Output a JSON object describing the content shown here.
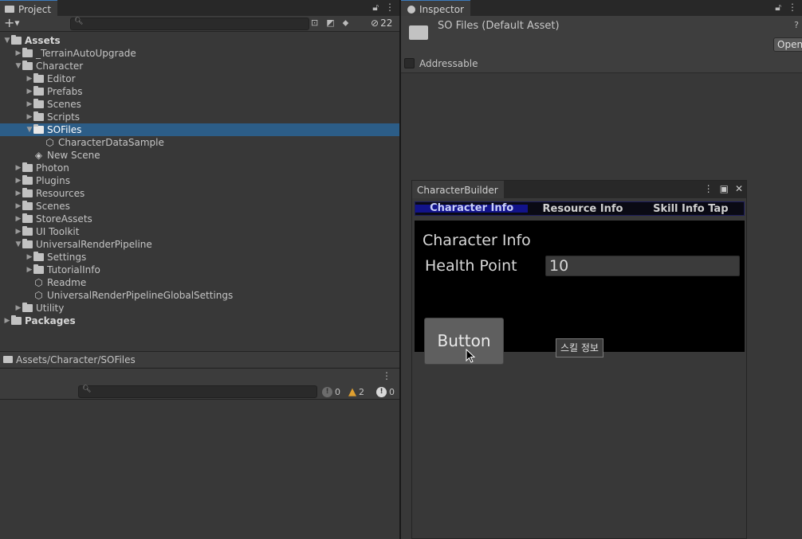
{
  "project": {
    "tab_title": "Project",
    "hidden_count": "22",
    "tree": [
      {
        "label": "Assets",
        "depth": 0,
        "expanded": true,
        "bold": true,
        "type": "folder"
      },
      {
        "label": "_TerrainAutoUpgrade",
        "depth": 1,
        "expanded": false,
        "type": "folder"
      },
      {
        "label": "Character",
        "depth": 1,
        "expanded": true,
        "type": "folder"
      },
      {
        "label": "Editor",
        "depth": 2,
        "expanded": false,
        "type": "folder"
      },
      {
        "label": "Prefabs",
        "depth": 2,
        "expanded": false,
        "type": "folder"
      },
      {
        "label": "Scenes",
        "depth": 2,
        "expanded": false,
        "type": "folder"
      },
      {
        "label": "Scripts",
        "depth": 2,
        "expanded": false,
        "type": "folder"
      },
      {
        "label": "SOFiles",
        "depth": 2,
        "expanded": true,
        "selected": true,
        "type": "folder"
      },
      {
        "label": "CharacterDataSample",
        "depth": 3,
        "type": "asset"
      },
      {
        "label": "New Scene",
        "depth": 2,
        "type": "scene"
      },
      {
        "label": "Photon",
        "depth": 1,
        "expanded": false,
        "type": "folder"
      },
      {
        "label": "Plugins",
        "depth": 1,
        "expanded": false,
        "type": "folder"
      },
      {
        "label": "Resources",
        "depth": 1,
        "expanded": false,
        "type": "folder"
      },
      {
        "label": "Scenes",
        "depth": 1,
        "expanded": false,
        "type": "folder"
      },
      {
        "label": "StoreAssets",
        "depth": 1,
        "expanded": false,
        "type": "folder"
      },
      {
        "label": "UI Toolkit",
        "depth": 1,
        "expanded": false,
        "type": "folder"
      },
      {
        "label": "UniversalRenderPipeline",
        "depth": 1,
        "expanded": true,
        "type": "folder"
      },
      {
        "label": "Settings",
        "depth": 2,
        "expanded": false,
        "type": "folder"
      },
      {
        "label": "TutorialInfo",
        "depth": 2,
        "expanded": false,
        "type": "folder"
      },
      {
        "label": "Readme",
        "depth": 2,
        "type": "asset"
      },
      {
        "label": "UniversalRenderPipelineGlobalSettings",
        "depth": 2,
        "type": "asset"
      },
      {
        "label": "Utility",
        "depth": 1,
        "expanded": false,
        "type": "folder"
      },
      {
        "label": "Packages",
        "depth": 0,
        "expanded": false,
        "bold": true,
        "type": "folder"
      }
    ],
    "path": "Assets/Character/SOFiles"
  },
  "console": {
    "info_count": "0",
    "warning_count": "2",
    "error_count": "0"
  },
  "inspector": {
    "tab_title": "Inspector",
    "asset_title": "SO Files (Default Asset)",
    "open_label": "Open",
    "addressable_label": "Addressable"
  },
  "builder": {
    "window_title": "CharacterBuilder",
    "tabs": [
      "Character Info",
      "Resource Info",
      "Skill Info Tap"
    ],
    "section_title": "Character Info",
    "field_label": "Health Point",
    "field_value": "10",
    "button_label": "Button",
    "tooltip": "스킬 정보"
  },
  "colors": {
    "selection": "#2c5d87",
    "active_tab_bg": "#12138a",
    "warning": "#e0a030"
  }
}
